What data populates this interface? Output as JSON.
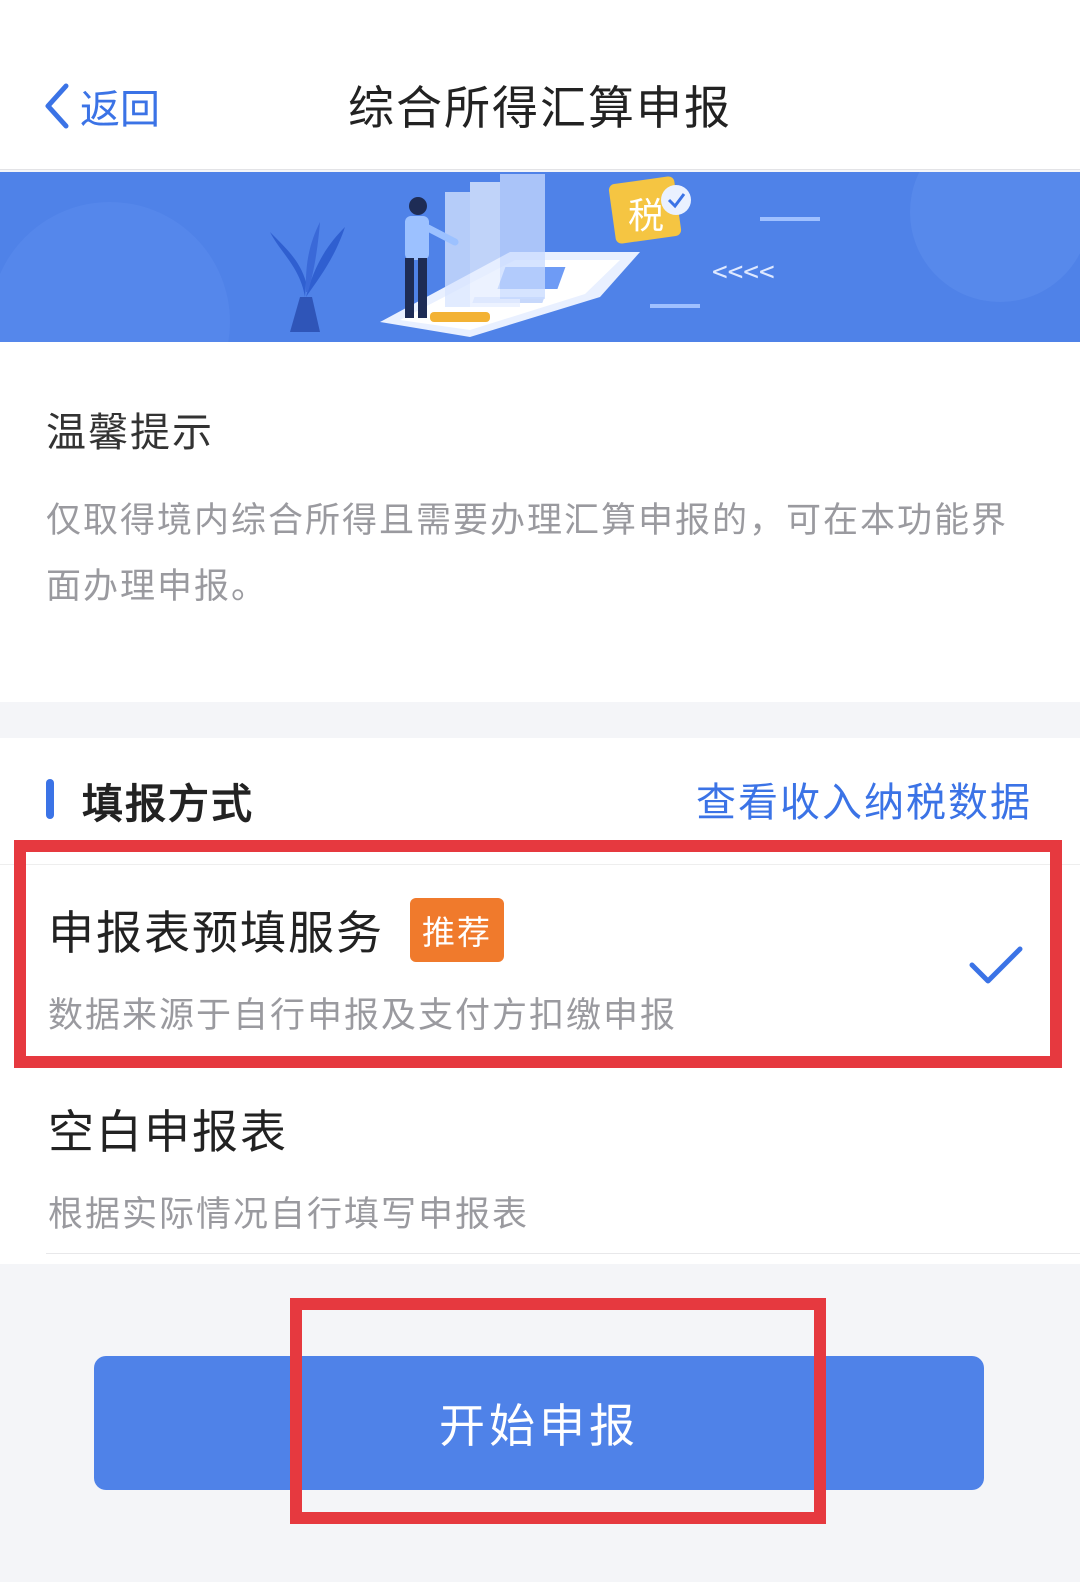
{
  "nav": {
    "back_label": "返回",
    "title": "综合所得汇算申报"
  },
  "banner": {
    "badge_text": "税",
    "arrows_text": "<<<<",
    "accent_color": "#4f82e8"
  },
  "tip": {
    "title": "温馨提示",
    "text": "仅取得境内综合所得且需要办理汇算申报的，可在本功能界面办理申报。"
  },
  "method": {
    "title": "填报方式",
    "view_link": "查看收入纳税数据",
    "options": [
      {
        "title": "申报表预填服务",
        "badge": "推荐",
        "subtitle": "数据来源于自行申报及支付方扣缴申报",
        "selected": true
      },
      {
        "title": "空白申报表",
        "subtitle": "根据实际情况自行填写申报表",
        "selected": false
      }
    ]
  },
  "action": {
    "start_label": "开始申报"
  },
  "colors": {
    "primary": "#3b73e6",
    "badge": "#f07a2c",
    "highlight": "#e6393f"
  },
  "icons": {
    "back": "chevron-left-icon",
    "check": "checkmark-icon"
  }
}
